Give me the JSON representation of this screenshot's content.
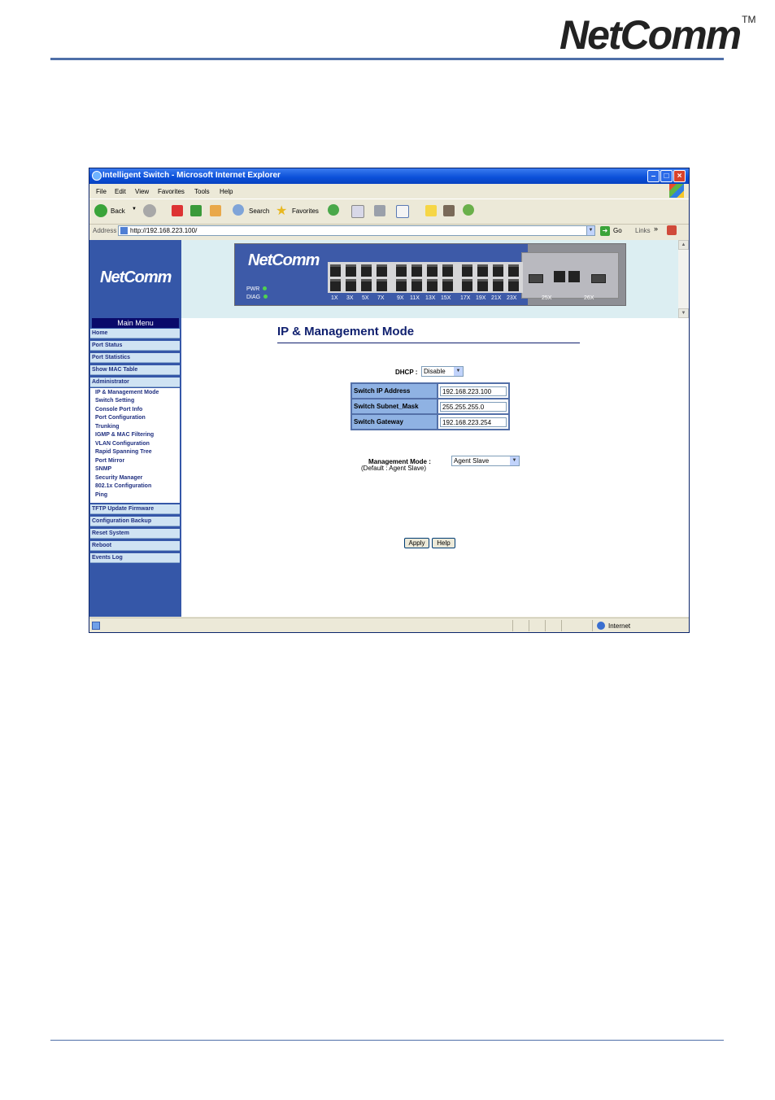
{
  "document": {
    "logo_text": "NetComm",
    "trademark": "TM"
  },
  "browser": {
    "window_title": "Intelligent Switch - Microsoft Internet Explorer",
    "menu": [
      "File",
      "Edit",
      "View",
      "Favorites",
      "Tools",
      "Help"
    ],
    "toolbar": {
      "back_label": "Back",
      "search_label": "Search",
      "favorites_label": "Favorites"
    },
    "address_label": "Address",
    "address_url": "http://192.168.223.100/",
    "go_label": "Go",
    "links_label": "Links",
    "links_chevron": "»",
    "status_zone": "Internet"
  },
  "switch_banner": {
    "logo_text": "NetComm",
    "pwr_label": "PWR",
    "diag_label": "DIAG",
    "port_labels": [
      "1X",
      "3X",
      "5X",
      "7X",
      "9X",
      "11X",
      "13X",
      "15X",
      "17X",
      "19X",
      "21X",
      "23X",
      "25X",
      "26X"
    ]
  },
  "sidebar": {
    "logo_text": "NetComm",
    "heading": "Main Menu",
    "top_items": [
      "Home",
      "Port Status",
      "Port Statistics",
      "Show MAC Table",
      "Administrator"
    ],
    "admin_sub_items": [
      "IP & Management Mode",
      "Switch Setting",
      "Console Port Info",
      "Port Configuration",
      "Trunking",
      "IGMP & MAC Filtering",
      "VLAN Configuration",
      "Rapid Spanning Tree",
      "Port Mirror",
      "SNMP",
      "Security Manager",
      "802.1x Configuration",
      "Ping"
    ],
    "bottom_items": [
      "TFTP Update Firmware",
      "Configuration Backup",
      "Reset System",
      "Reboot",
      "Events Log"
    ]
  },
  "main": {
    "title": "IP & Management Mode",
    "dhcp_label": "DHCP :",
    "dhcp_value": "Disable",
    "ip_table": [
      {
        "label": "Switch IP Address",
        "value": "192.168.223.100"
      },
      {
        "label": "Switch Subnet_Mask",
        "value": "255.255.255.0"
      },
      {
        "label": "Switch Gateway",
        "value": "192.168.223.254"
      }
    ],
    "mgmt_label": "Management Mode :",
    "mgmt_value": "Agent Slave",
    "default_note": "(Default : Agent Slave)",
    "apply_label": "Apply",
    "help_label": "Help"
  },
  "colors": {
    "accent_rule": "#4f6fa8",
    "sidebar_bg": "#3557a8",
    "title_text": "#0f1f6e"
  }
}
